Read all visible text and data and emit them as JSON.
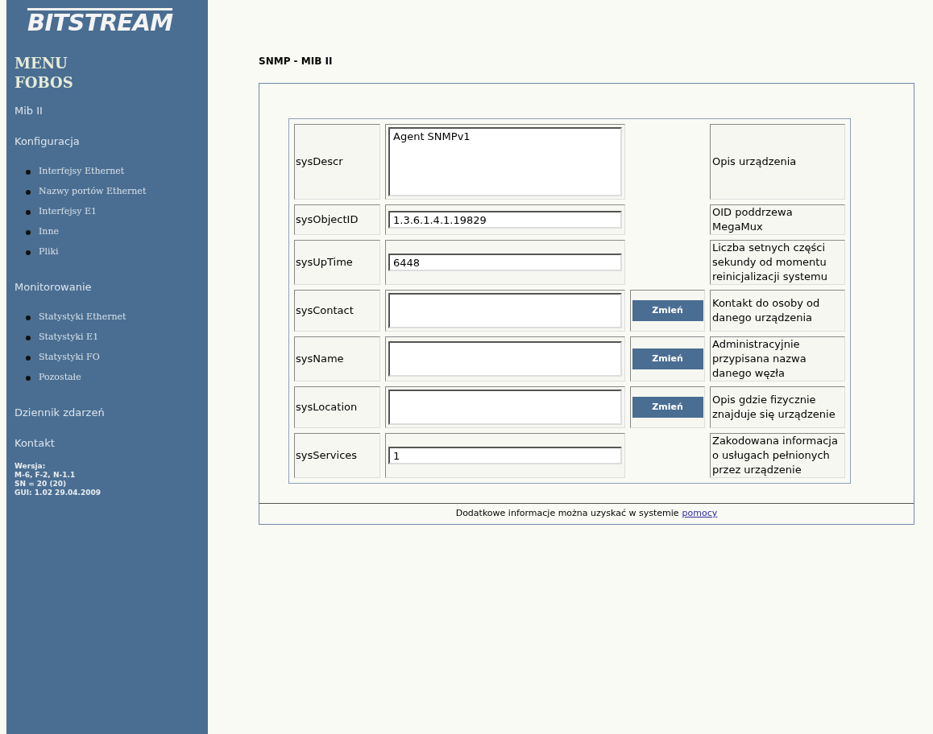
{
  "logo": "BITSTREAM",
  "menu_title": [
    "MENU",
    "FOBOS"
  ],
  "sidebar": [
    {
      "kind": "section",
      "label": "Mib II"
    },
    {
      "kind": "section",
      "label": "Konfiguracja",
      "items": [
        "Interfejsy Ethernet",
        "Nazwy portów Ethernet",
        "Interfejsy E1",
        "Inne",
        "Pliki"
      ]
    },
    {
      "kind": "section",
      "label": "Monitorowanie",
      "items": [
        "Statystyki Ethernet",
        "Statystyki E1",
        "Statystyki FO",
        "Pozostałe"
      ]
    },
    {
      "kind": "section",
      "label": "Dziennik zdarzeń"
    },
    {
      "kind": "section",
      "label": "Kontakt"
    }
  ],
  "version": [
    "Wersja:",
    "M-6, F-2, N-1.1",
    "SN = 20 (20)",
    "GUI: 1.02 29.04.2009"
  ],
  "page_title": "SNMP - MIB II",
  "rows": [
    {
      "name": "sysDescr",
      "kind": "textarea",
      "value": "Agent SNMPv1",
      "description": "Opis urządzenia"
    },
    {
      "name": "sysObjectID",
      "kind": "input",
      "value": "1.3.6.1.4.1.19829",
      "description": "OID poddrzewa MegaMux"
    },
    {
      "name": "sysUpTime",
      "kind": "input",
      "value": "6448",
      "description": "Liczba setnych części sekundy od momentu reinicjalizacji systemu"
    },
    {
      "name": "sysContact",
      "kind": "input_tall",
      "button": "Zmień",
      "description": "Kontakt do osoby od danego urządzenia"
    },
    {
      "name": "sysName",
      "kind": "input_tall",
      "button": "Zmień",
      "description": "Administracyjnie przypisana nazwa danego węzła"
    },
    {
      "name": "sysLocation",
      "kind": "input_tall",
      "button": "Zmień",
      "description": "Opis gdzie fizycznie znajduje się urządzenie"
    },
    {
      "name": "sysServices",
      "kind": "input",
      "value": "1",
      "description": "Zakodowana informacja o usługach pełnionych przez urządzenie"
    }
  ],
  "footer": {
    "text": "Dodatkowe informacje można uzyskać w systemie",
    "link": "pomocy"
  }
}
